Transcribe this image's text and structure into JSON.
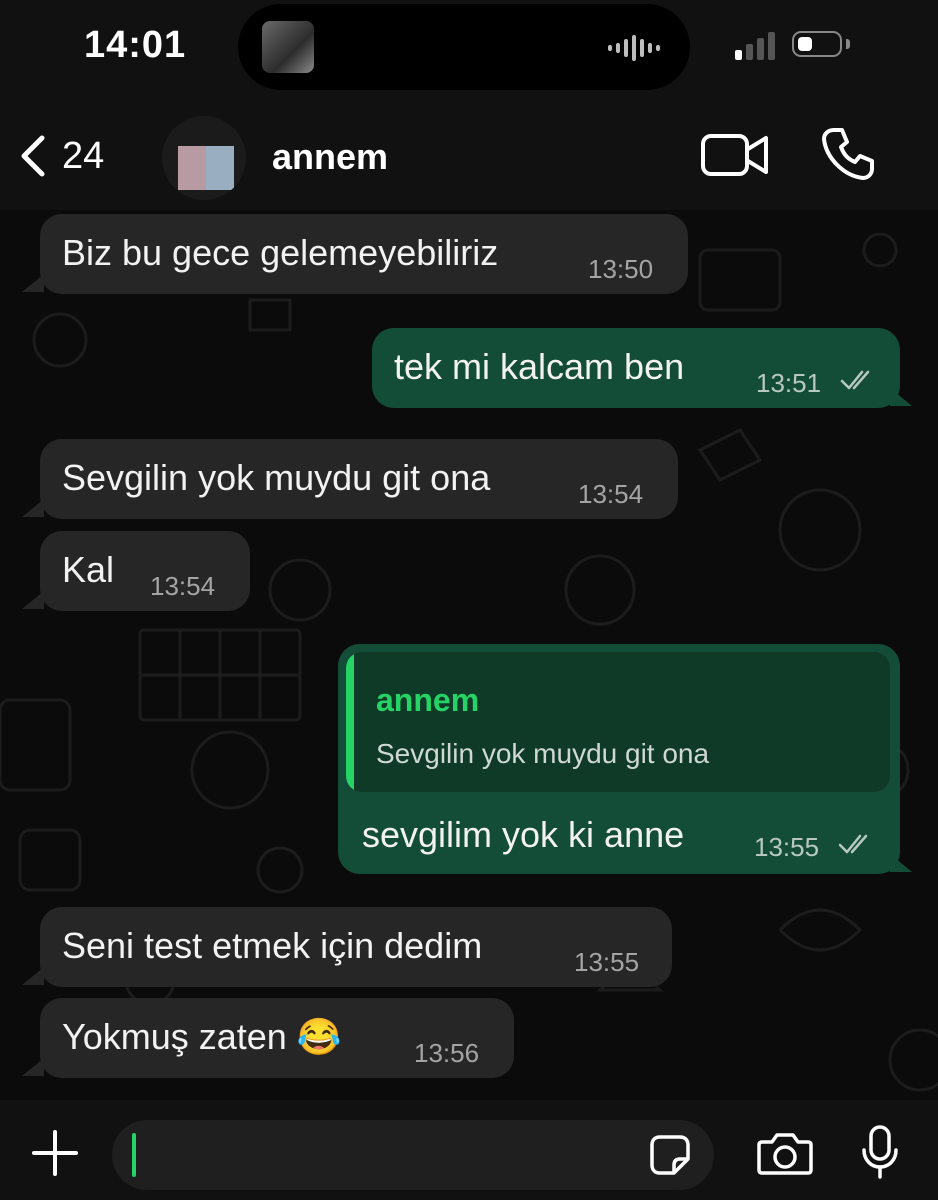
{
  "status_bar": {
    "time": "14:01"
  },
  "header": {
    "back_count": "24",
    "contact_name": "annem"
  },
  "messages": [
    {
      "direction": "in",
      "text": "Biz bu gece gelemeyebiliriz",
      "time": "13:50"
    },
    {
      "direction": "out",
      "text": "tek mi kalcam ben",
      "time": "13:51",
      "status": "read"
    },
    {
      "direction": "in",
      "text": "Sevgilin yok muydu git ona",
      "time": "13:54"
    },
    {
      "direction": "in",
      "text": "Kal",
      "time": "13:54"
    },
    {
      "direction": "out",
      "text": "sevgilim yok ki anne",
      "time": "13:55",
      "status": "read",
      "reply_to": {
        "author": "annem",
        "text": "Sevgilin yok muydu git ona"
      }
    },
    {
      "direction": "in",
      "text": "Seni test etmek için dedim",
      "time": "13:55"
    },
    {
      "direction": "in",
      "text": "Yokmuş zaten 😂",
      "time": "13:56"
    }
  ],
  "composer": {
    "value": ""
  },
  "colors": {
    "accent": "#25d366",
    "outgoing_bubble": "#144d37",
    "incoming_bubble": "#262626"
  },
  "icons": [
    "back-chevron-icon",
    "video-call-icon",
    "phone-icon",
    "plus-icon",
    "sticker-icon",
    "camera-icon",
    "microphone-icon",
    "double-check-icon"
  ]
}
